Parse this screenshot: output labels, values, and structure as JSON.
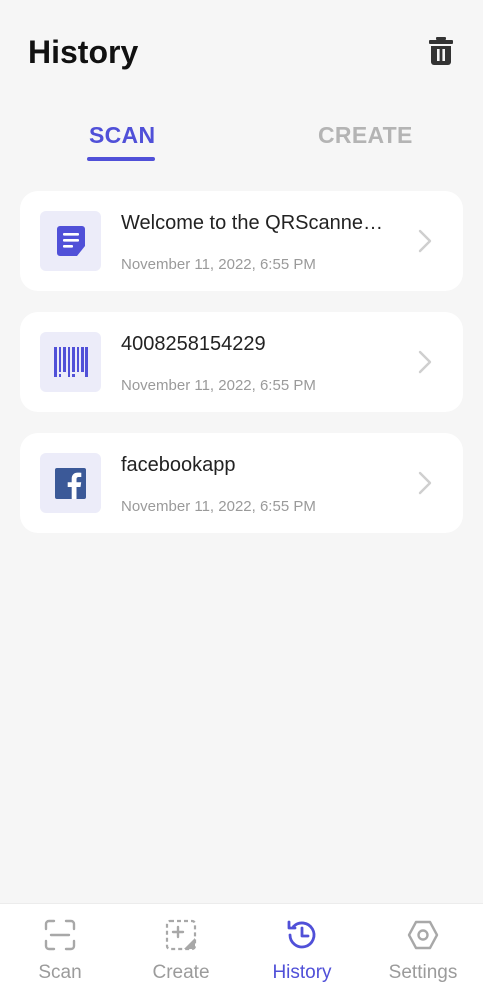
{
  "header": {
    "title": "History"
  },
  "tabs": [
    {
      "label": "SCAN",
      "active": true
    },
    {
      "label": "CREATE",
      "active": false
    }
  ],
  "history": [
    {
      "title": "Welcome to the QRScanne…",
      "date": "November 11, 2022, 6:55 PM",
      "icon": "text-note-icon"
    },
    {
      "title": "4008258154229",
      "date": "November 11, 2022, 6:55 PM",
      "icon": "barcode-icon"
    },
    {
      "title": "facebookapp",
      "date": "November 11, 2022, 6:55 PM",
      "icon": "facebook-icon"
    }
  ],
  "bottom_nav": [
    {
      "label": "Scan",
      "icon": "scan-icon",
      "active": false
    },
    {
      "label": "Create",
      "icon": "create-icon",
      "active": false
    },
    {
      "label": "History",
      "icon": "history-icon",
      "active": true
    },
    {
      "label": "Settings",
      "icon": "settings-icon",
      "active": false
    }
  ],
  "colors": {
    "accent": "#5050d8",
    "inactive": "#b4b4b4",
    "background": "#f6f6f6",
    "facebook": "#3b5998"
  }
}
